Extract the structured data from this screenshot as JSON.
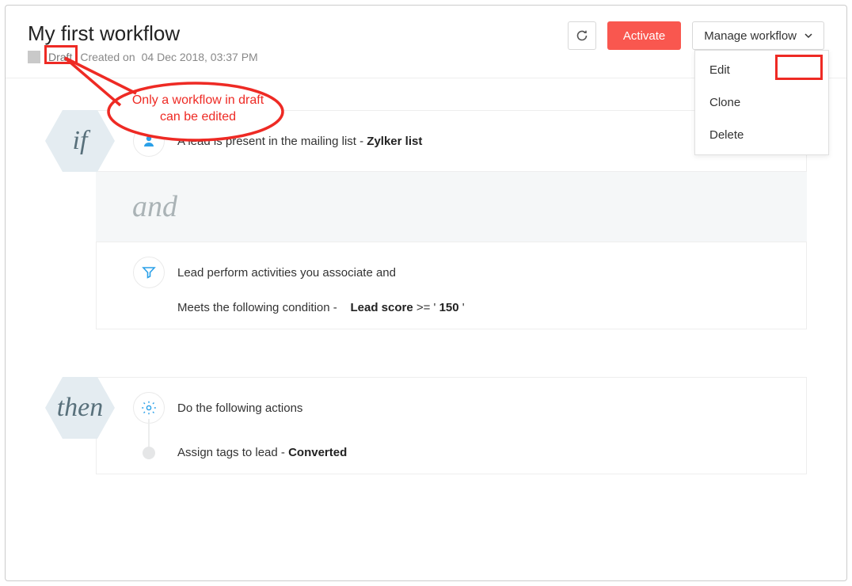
{
  "header": {
    "title": "My first workflow",
    "status": "Draft",
    "created_label": "Created on",
    "created_date": "04 Dec 2018, 03:37 PM",
    "activate": "Activate",
    "manage": "Manage workflow"
  },
  "dropdown": {
    "edit": "Edit",
    "clone": "Clone",
    "delete": "Delete"
  },
  "annotation": {
    "text": "Only a workflow in draft can be edited"
  },
  "if_block": {
    "label": "if",
    "condition1_pre": "A lead is present in the mailing list - ",
    "condition1_val": "Zylker list",
    "and": "and",
    "condition2_title": "Lead perform activities you associate and",
    "condition2_pre": "Meets the following condition - ",
    "condition2_field": "Lead score",
    "condition2_op": " >= ' ",
    "condition2_val": "150",
    "condition2_suf": " '"
  },
  "then_block": {
    "label": "then",
    "title": "Do the following actions",
    "action_pre": "Assign tags to lead - ",
    "action_val": "Converted"
  }
}
